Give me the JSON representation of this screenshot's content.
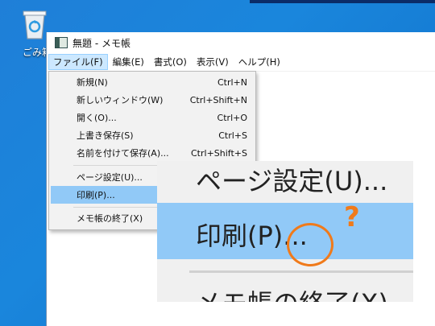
{
  "desktop": {
    "recycle_bin_label": "ごみ箱"
  },
  "window": {
    "title": "無題 - メモ帳"
  },
  "menubar": {
    "items": [
      {
        "label": "ファイル(F)"
      },
      {
        "label": "編集(E)"
      },
      {
        "label": "書式(O)"
      },
      {
        "label": "表示(V)"
      },
      {
        "label": "ヘルプ(H)"
      }
    ]
  },
  "file_menu": {
    "items": [
      {
        "label": "新規(N)",
        "shortcut": "Ctrl+N"
      },
      {
        "label": "新しいウィンドウ(W)",
        "shortcut": "Ctrl+Shift+N"
      },
      {
        "label": "開く(O)...",
        "shortcut": "Ctrl+O"
      },
      {
        "label": "上書き保存(S)",
        "shortcut": "Ctrl+S"
      },
      {
        "label": "名前を付けて保存(A)...",
        "shortcut": "Ctrl+Shift+S"
      },
      {
        "label": "ページ設定(U)...",
        "shortcut": ""
      },
      {
        "label": "印刷(P)...",
        "shortcut": ""
      },
      {
        "label": "メモ帳の終了(X)",
        "shortcut": ""
      }
    ]
  },
  "zoom_callout": {
    "page_setup": "ページ設定(U)...",
    "print": "印刷(P)...",
    "exit": "メモ帳の終了(X)",
    "question_mark": "?"
  },
  "colors": {
    "highlight": "#91c9f7",
    "annotation": "#f07a1a",
    "desktop": "#1a86dc"
  }
}
